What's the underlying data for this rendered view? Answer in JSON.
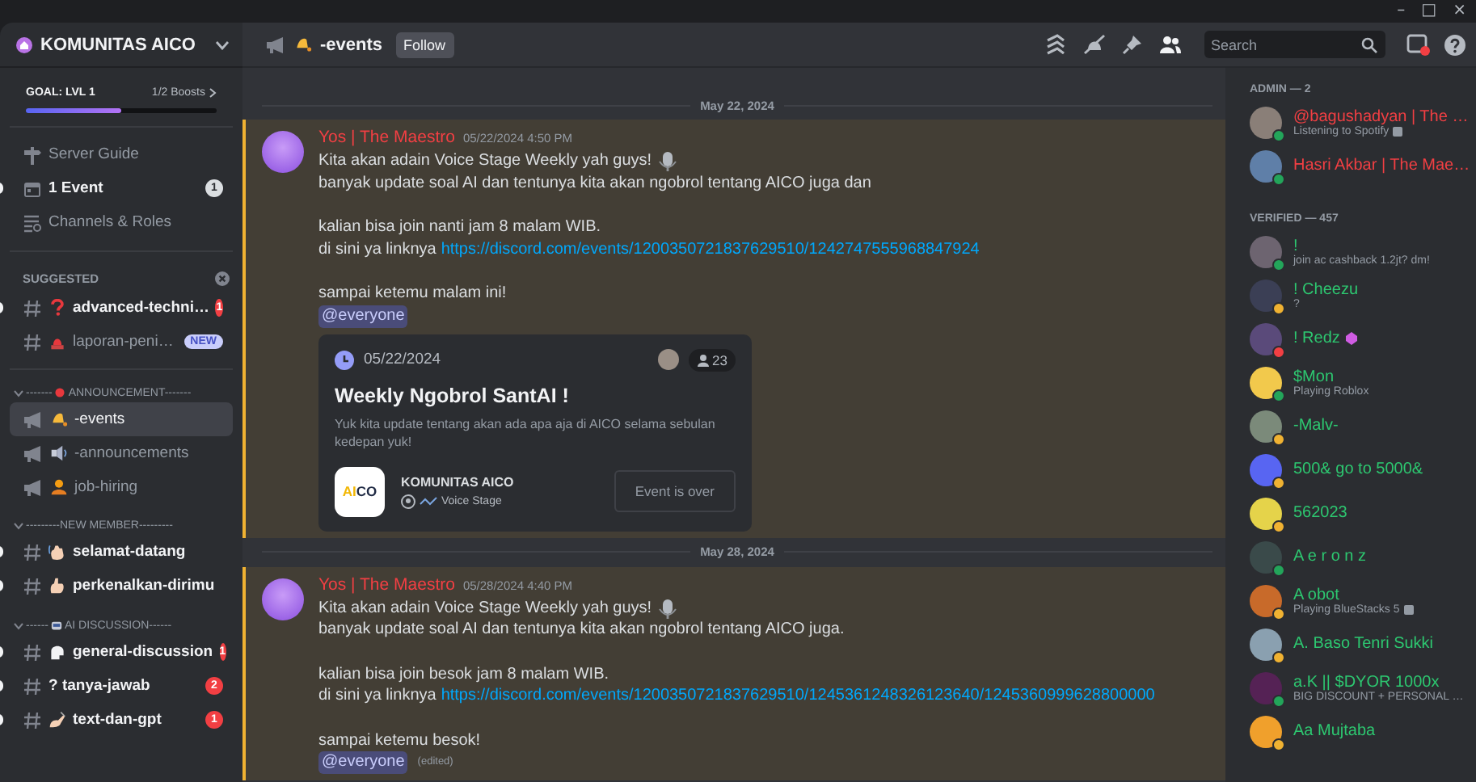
{
  "window": {
    "controls": [
      "–",
      "□",
      "×"
    ]
  },
  "server": {
    "name": "KOMUNITAS AICO",
    "goal": "GOAL: LVL 1",
    "boosts": "1/2 Boosts",
    "level": 0.5
  },
  "guide": [
    {
      "label": "Server Guide",
      "unread": false
    },
    {
      "label": "1 Event",
      "unread": true,
      "count": "1"
    },
    {
      "label": "Channels & Roles",
      "unread": false
    }
  ],
  "suggested": {
    "title": "SUGGESTED",
    "channels": [
      {
        "name": "advanced-techni…",
        "kind": "text",
        "unread": true,
        "mentions": "1",
        "selected": false
      },
      {
        "name": "laporan-peni…",
        "kind": "text",
        "unread": false,
        "badge": "NEW",
        "selected": false
      }
    ]
  },
  "categories": [
    {
      "prefix": "-------",
      "label": "ANNOUNCEMENT-------",
      "channels": [
        {
          "name": "-events",
          "kind": "announcement",
          "unread": false,
          "selected": true
        },
        {
          "name": "-announcements",
          "kind": "announcement",
          "unread": false,
          "selected": false
        },
        {
          "name": "job-hiring",
          "kind": "announcement",
          "unread": false,
          "selected": false
        }
      ]
    },
    {
      "label": "---------NEW MEMBER---------",
      "channels": [
        {
          "name": "selamat-datang",
          "kind": "text",
          "unread": true,
          "selected": false
        },
        {
          "name": "perkenalkan-dirimu",
          "kind": "text",
          "unread": true,
          "selected": false
        }
      ]
    },
    {
      "prefix": "------",
      "label": "AI DISCUSSION------",
      "channels": [
        {
          "name": "general-discussion",
          "kind": "text",
          "unread": true,
          "mentions": "1",
          "selected": false
        },
        {
          "name": "? tanya-jawab",
          "kind": "text",
          "unread": true,
          "mentions": "2",
          "selected": false
        },
        {
          "name": "text-dan-gpt",
          "kind": "text",
          "unread": true,
          "mentions": "1",
          "selected": false
        }
      ]
    }
  ],
  "header": {
    "channel": "-events",
    "follow": "Follow",
    "search": {
      "placeholder": "Search"
    },
    "inbox_unread": true
  },
  "messages": [
    {
      "date": "May 22, 2024",
      "author": "Yos | The Maestro",
      "time": "05/22/2024 4:50 PM",
      "mentioned": true,
      "lines": [
        {
          "text": "Kita akan adain Voice Stage Weekly yah guys!",
          "trailing_emoji": true
        },
        {
          "text": "banyak update soal AI dan tentunya kita akan ngobrol tentang AICO juga dan"
        },
        {
          "text": "kalian bisa join nanti jam 8 malam WIB.",
          "gap": true
        },
        {
          "text": "di sini ya linknya",
          "link": "https://discord.com/events/1200350721837629510/1242747555968847924"
        },
        {
          "text": "sampai ketemu malam ini!",
          "gap": true
        }
      ],
      "mention": "@everyone",
      "event": {
        "date": "05/22/2024",
        "interested": "23",
        "title": "Weekly Ngobrol SantAI !",
        "description": "Yuk kita update tentang akan ada apa aja di AICO selama sebulan kedepan yuk!",
        "logo": [
          {
            "text": "AI",
            "color": "#f2b705"
          },
          {
            "text": "CO",
            "color": "#1f2a44"
          }
        ],
        "server": "KOMUNITAS AICO",
        "location": "Voice Stage",
        "button": "Event is over",
        "disabled": true
      }
    },
    {
      "date": "May 28, 2024",
      "author": "Yos | The Maestro",
      "time": "05/28/2024 4:40 PM",
      "mentioned": true,
      "lines": [
        {
          "text": "Kita akan adain Voice Stage Weekly yah guys!",
          "trailing_emoji": true
        },
        {
          "text": "banyak update soal AI dan tentunya kita akan ngobrol tentang AICO juga."
        },
        {
          "text": "kalian bisa join besok jam 8 malam WIB.",
          "gap": true
        },
        {
          "text": "di sini ya linknya",
          "link": "https://discord.com/events/1200350721837629510/1245361248326123640/1245360999628800000"
        },
        {
          "text": "sampai ketemu besok!",
          "gap": true
        }
      ],
      "mention": "@everyone",
      "edited": "(edited)"
    }
  ],
  "member_groups": [
    {
      "title": "ADMIN — 2",
      "color": "#f23f43",
      "members": [
        {
          "name": "@bagushadyan | The …",
          "activity": "Listening to Spotify",
          "activity_icon": true,
          "color": "#23a55a"
        },
        {
          "name": "Hasri Akbar | The Mae…",
          "color": "#23a55a"
        }
      ]
    },
    {
      "title": "VERIFIED — 457",
      "color": "#2dc770",
      "members": [
        {
          "name": "!",
          "activity": "join ac cashback 1.2jt? dm!",
          "color": "#23a55a"
        },
        {
          "name": "! Cheezu",
          "activity": "?",
          "color": "#f0b232"
        },
        {
          "name": "! Redz",
          "gem": true,
          "color": "#f23f43"
        },
        {
          "name": "$Mon",
          "activity": "Playing Roblox",
          "color": "#23a55a"
        },
        {
          "name": "-Malv-",
          "color": "#f0b232"
        },
        {
          "name": "500& go to 5000&",
          "color": "#f0b232"
        },
        {
          "name": "562023",
          "color": "#f0b232"
        },
        {
          "name": "A e r o n z",
          "color": "#23a55a"
        },
        {
          "name": "A obot",
          "activity": "Playing BlueStacks 5",
          "activity_icon": true,
          "color": "#f0b232"
        },
        {
          "name": "A. Baso Tenri Sukki",
          "color": "#f0b232"
        },
        {
          "name": "a.K || $DYOR 1000x",
          "activity": "BIG DISCOUNT + PERSONAL …",
          "color": "#23a55a"
        },
        {
          "name": "Aa Mujtaba",
          "color": "#f0b232"
        }
      ]
    }
  ]
}
